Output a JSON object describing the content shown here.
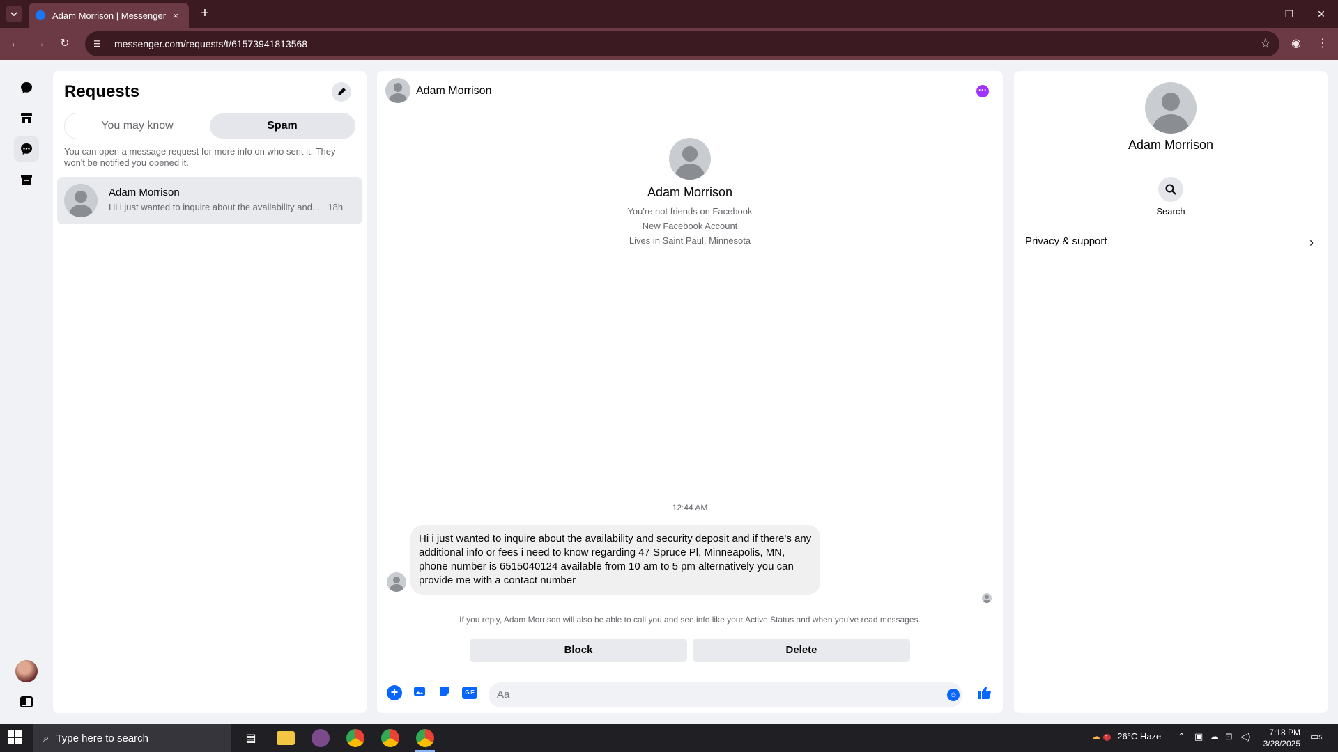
{
  "browser": {
    "tab_title": "Adam Morrison | Messenger",
    "url": "messenger.com/requests/t/61573941813568",
    "new_tab": "+",
    "close_tab": "×"
  },
  "sidebar": {
    "title": "Requests",
    "tabs": [
      "You may know",
      "Spam"
    ],
    "active_tab": "Spam",
    "hint": "You can open a message request for more info on who sent it. They won't be notified you opened it.",
    "conversations": [
      {
        "name": "Adam Morrison",
        "snippet": "Hi i just wanted to inquire about the availability and...",
        "time": "18h"
      }
    ]
  },
  "chat": {
    "header_name": "Adam Morrison",
    "profile": {
      "name": "Adam Morrison",
      "line1": "You're not friends on Facebook",
      "line2": "New Facebook Account",
      "line3": "Lives in Saint Paul, Minnesota"
    },
    "timestamp": "12:44 AM",
    "message": "Hi i just wanted to inquire about the availability and security deposit and if there's any additional info or fees i need to know regarding 47 Spruce Pl, Minneapolis, MN, phone number is 6515040124 available from 10 am to 5 pm alternatively you can provide me with a contact number",
    "reply_note": "If you reply, Adam Morrison will also be able to call you and see info like your Active Status and when you've read messages.",
    "block_label": "Block",
    "delete_label": "Delete",
    "input_placeholder": "Aa",
    "gif_label": "GIF"
  },
  "info_panel": {
    "name": "Adam Morrison",
    "search_label": "Search",
    "privacy_label": "Privacy & support"
  },
  "taskbar": {
    "search_placeholder": "Type here to search",
    "weather": "26°C  Haze",
    "time": "7:18 PM",
    "date": "3/28/2025",
    "notif_count": "5",
    "weather_badge": "1"
  },
  "colors": {
    "accent": "#0866ff",
    "chrome_dark": "#3c1a22",
    "chrome_light": "#6b3a45",
    "more_button": "#a033ff"
  }
}
